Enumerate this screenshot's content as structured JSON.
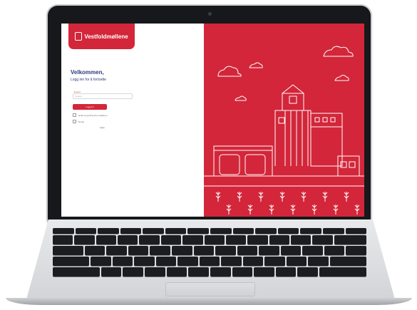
{
  "login": {
    "brand": "Vestfoldmøllene",
    "welcome": "Velkommen,",
    "subtitle": "Logg inn for å fortsette",
    "email_label": "E-post",
    "email_placeholder": "E-post",
    "button": "Logg inn",
    "option1": "Husk meg på denne maskinen",
    "option2": "Norsk",
    "footer": "Hjelp"
  },
  "colors": {
    "brand_red": "#d3263a",
    "navy": "#2c3b7d"
  },
  "icons": [
    "logo-mark-icon",
    "farm-illustration",
    "cloud-icon"
  ]
}
